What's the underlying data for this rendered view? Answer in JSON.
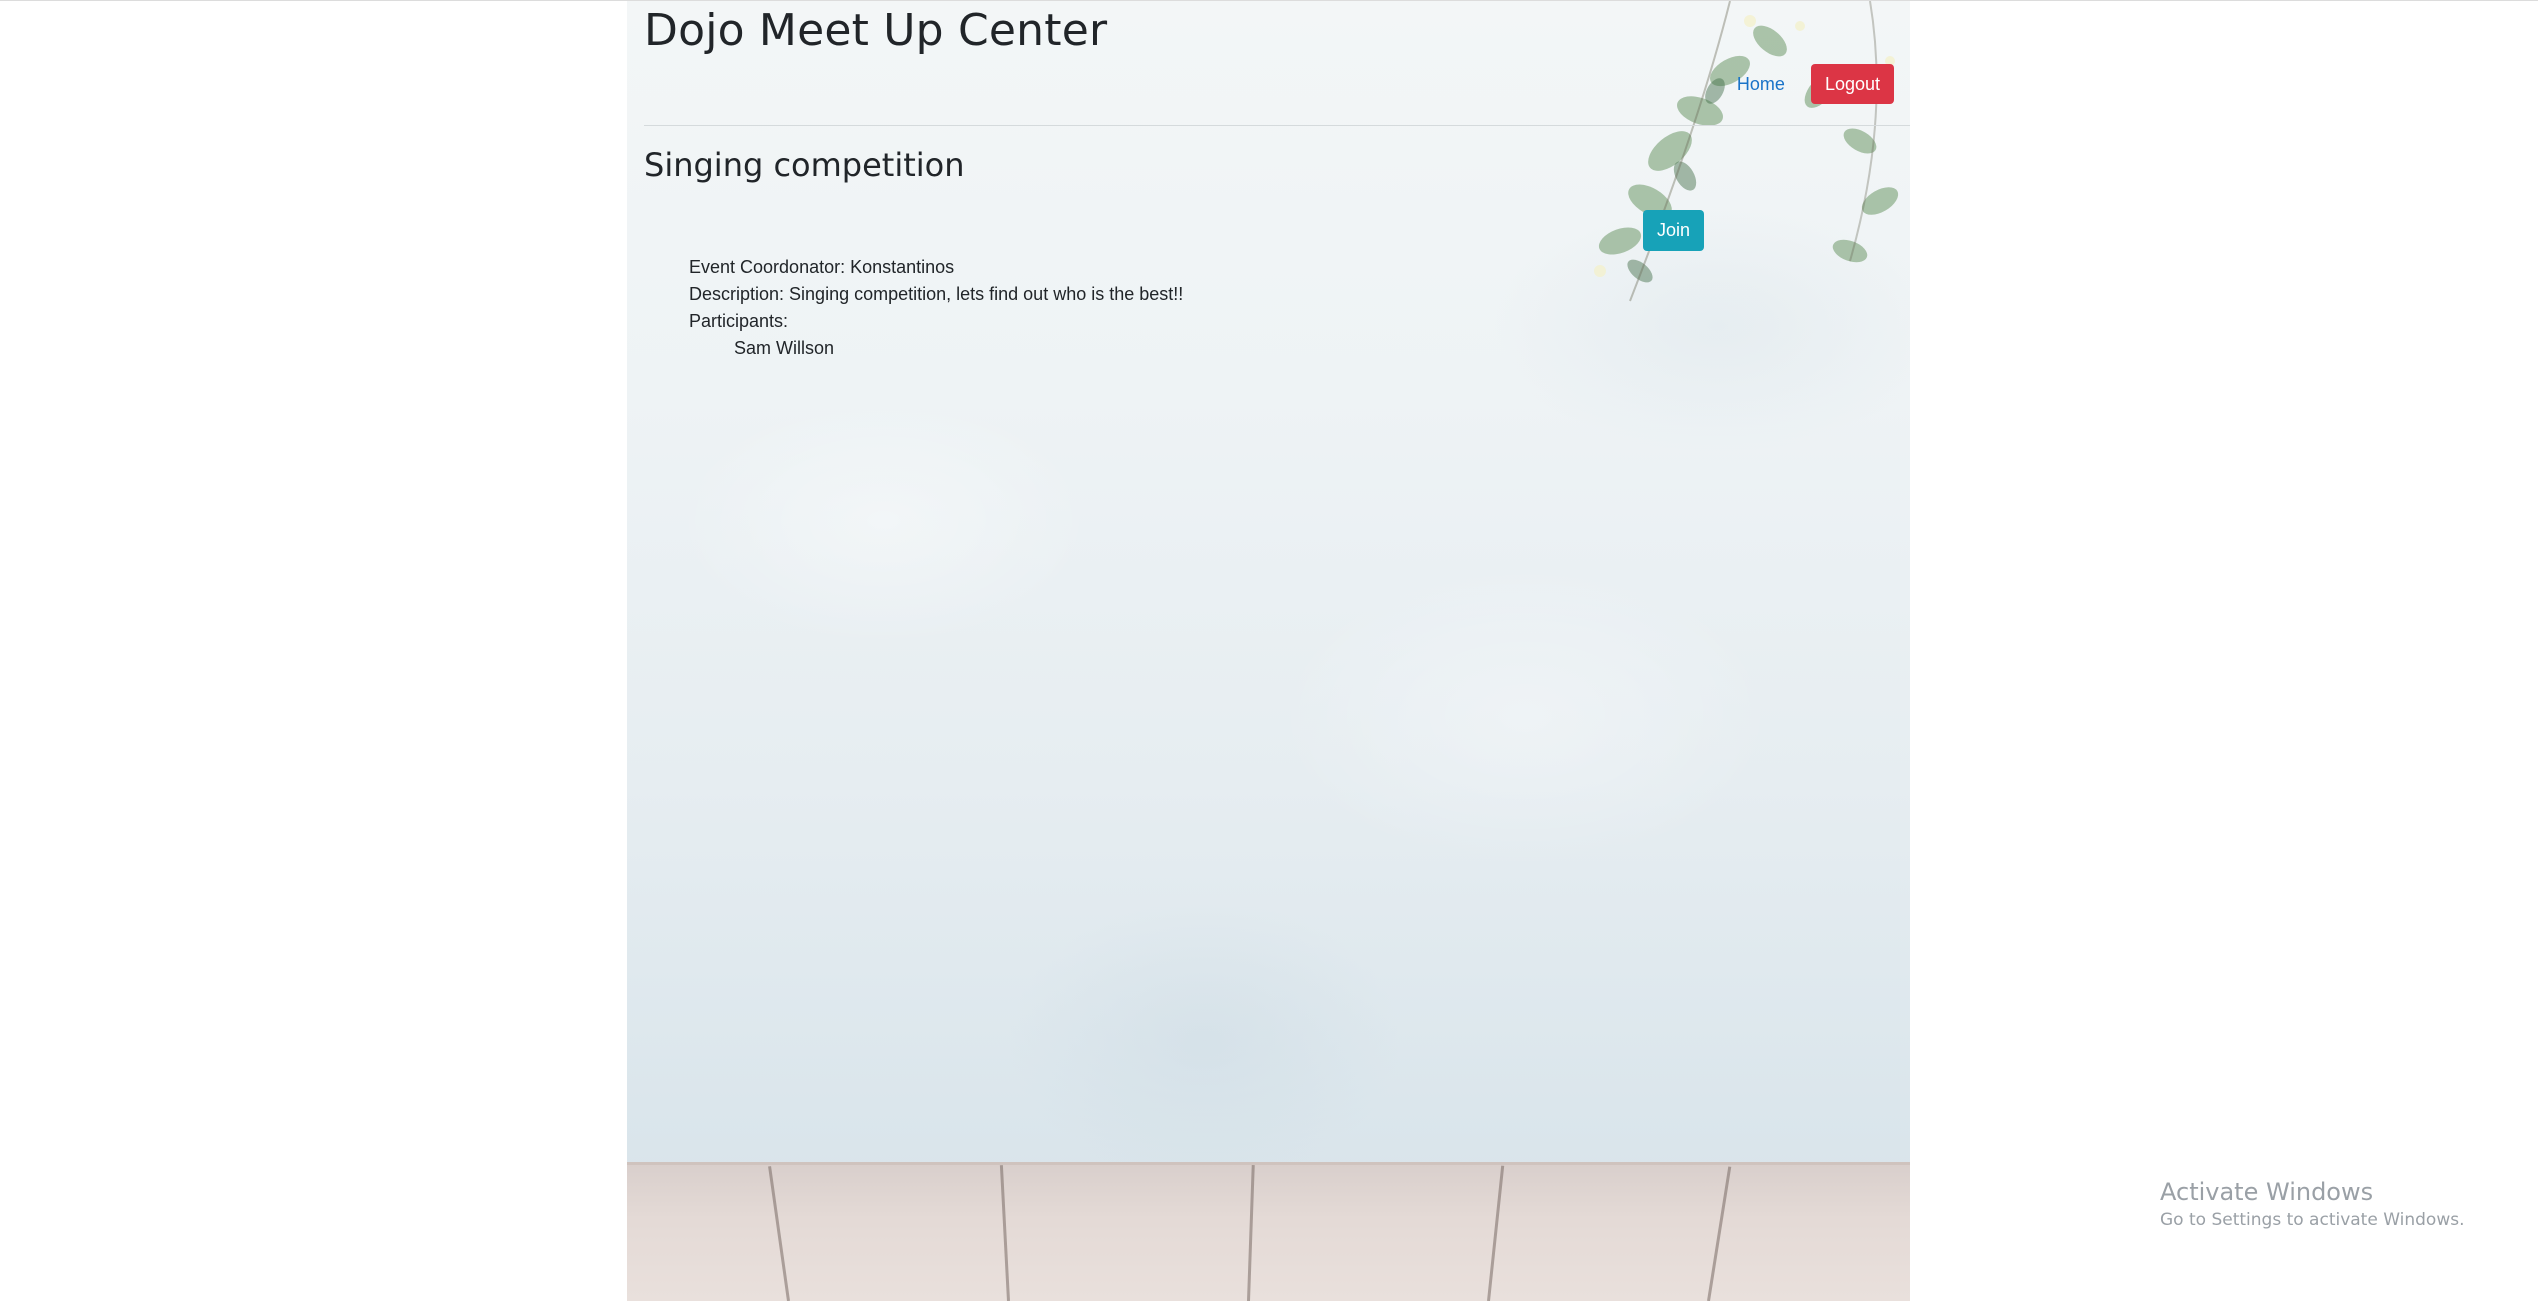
{
  "header": {
    "site_title": "Dojo Meet Up Center",
    "nav_home": "Home",
    "nav_logout": "Logout"
  },
  "event": {
    "title": "Singing competition",
    "join_label": "Join",
    "coordinator_line": "Event Coordonator: Konstantinos",
    "description_line": "Description: Singing competition, lets find out who is the best!!",
    "participants_label": "Participants:",
    "participants": [
      "Sam Willson"
    ]
  },
  "os_overlay": {
    "activate_title": "Activate Windows",
    "activate_sub": "Go to Settings to activate Windows."
  },
  "colors": {
    "logout": "#dc3545",
    "join": "#17a2b8",
    "link": "#1a73c8"
  }
}
